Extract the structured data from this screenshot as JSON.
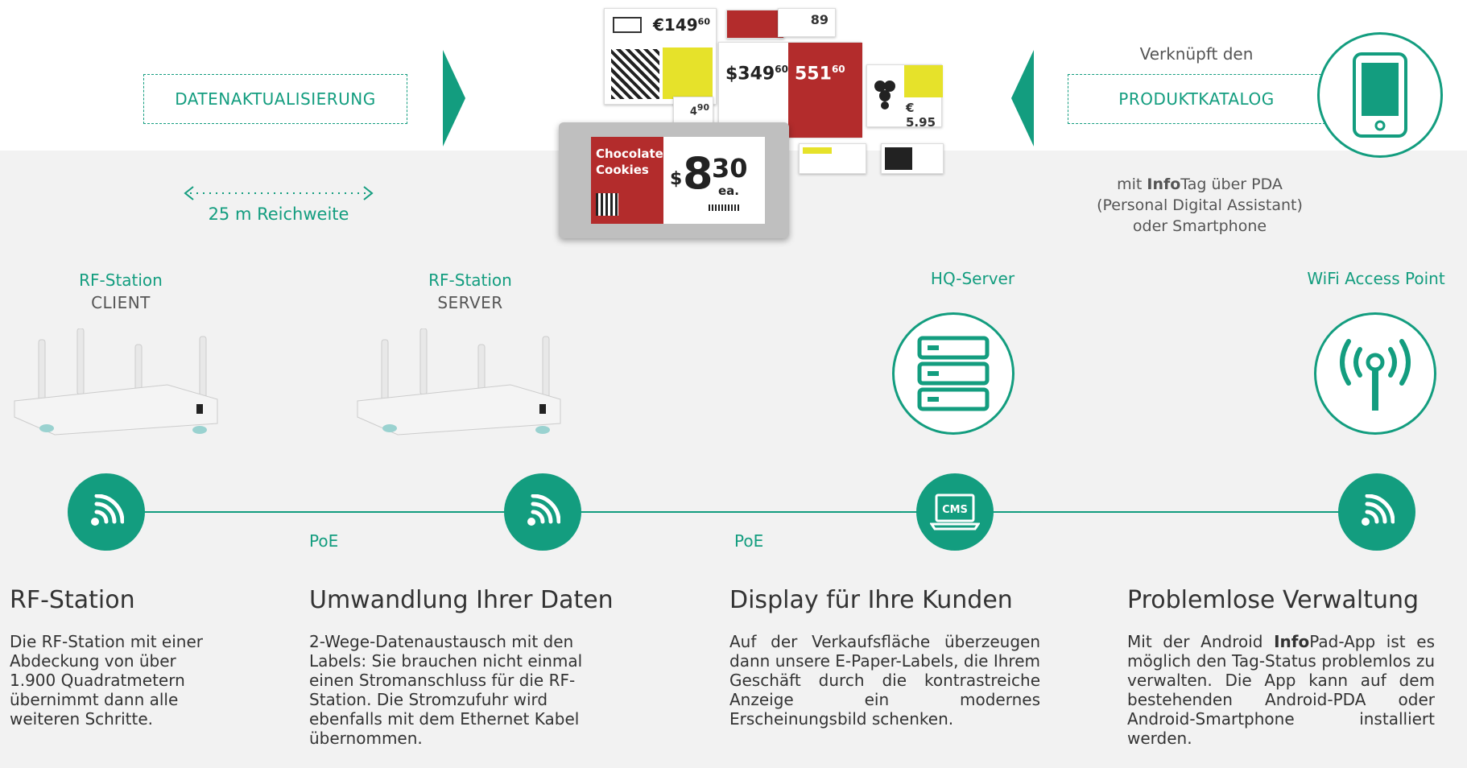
{
  "header": {
    "left_box": "DATENAKTUALISIERUNG",
    "right_box": "PRODUKTKATALOG",
    "right_caption": "Verknüpft den",
    "range_text": "25 m Reichweite",
    "pda_line1_bold": "Info",
    "pda_line1_pre": "mit ",
    "pda_line1_post": "Tag über PDA",
    "pda_line2": "(Personal Digital Assistant)",
    "pda_line3": "oder Smartphone"
  },
  "main_tag": {
    "product_line1": "Chocolate",
    "product_line2": "Cookies",
    "currency": "$",
    "price_big": "8",
    "price_cents": "30",
    "unit": "ea."
  },
  "stations": [
    {
      "title": "RF-Station",
      "subtitle": "CLIENT"
    },
    {
      "title": "RF-Station",
      "subtitle": "SERVER"
    },
    {
      "title": "HQ-Server",
      "subtitle": ""
    },
    {
      "title": "WiFi Access Point",
      "subtitle": ""
    }
  ],
  "links": {
    "poe1": "PoE",
    "poe2": "PoE",
    "cms_label": "CMS"
  },
  "columns": [
    {
      "title": "RF-Station",
      "body": "Die RF-Station mit einer Abdeckung von über 1.900 Quadratmetern übernimmt dann alle weiteren Schritte."
    },
    {
      "title": "Umwandlung Ihrer Daten",
      "body": "2-Wege-Datenaustausch mit den Labels: Sie brauchen nicht einmal einen Stromanschluss für die RF-Station. Die Stromzufuhr wird ebenfalls mit dem Ethernet Kabel übernommen."
    },
    {
      "title": "Display für Ihre Kunden",
      "body": "Auf der Verkaufsfläche überzeugen dann unsere E-Paper-Labels, die Ihrem Geschäft durch die kontrastreiche Anzeige ein modernes Erscheinungsbild schenken."
    },
    {
      "title": "Problemlose Verwaltung",
      "body_pre": "Mit der Android ",
      "body_bold": "Info",
      "body_post": "Pad-App ist es möglich den Tag-Status problemlos zu verwalten. Die App kann auf dem bestehenden Android-PDA oder Android-Smartphone installiert werden."
    }
  ],
  "colors": {
    "accent": "#139d7f",
    "background": "#f2f2f2",
    "red_tag": "#b32c2c",
    "yellow_tag": "#e6e22a"
  },
  "icons": [
    "phone-icon",
    "server-icon",
    "wifi-tower-icon",
    "wireless-signal-icon",
    "cms-laptop-icon",
    "double-arrow-icon",
    "triangle-arrow-icon"
  ]
}
